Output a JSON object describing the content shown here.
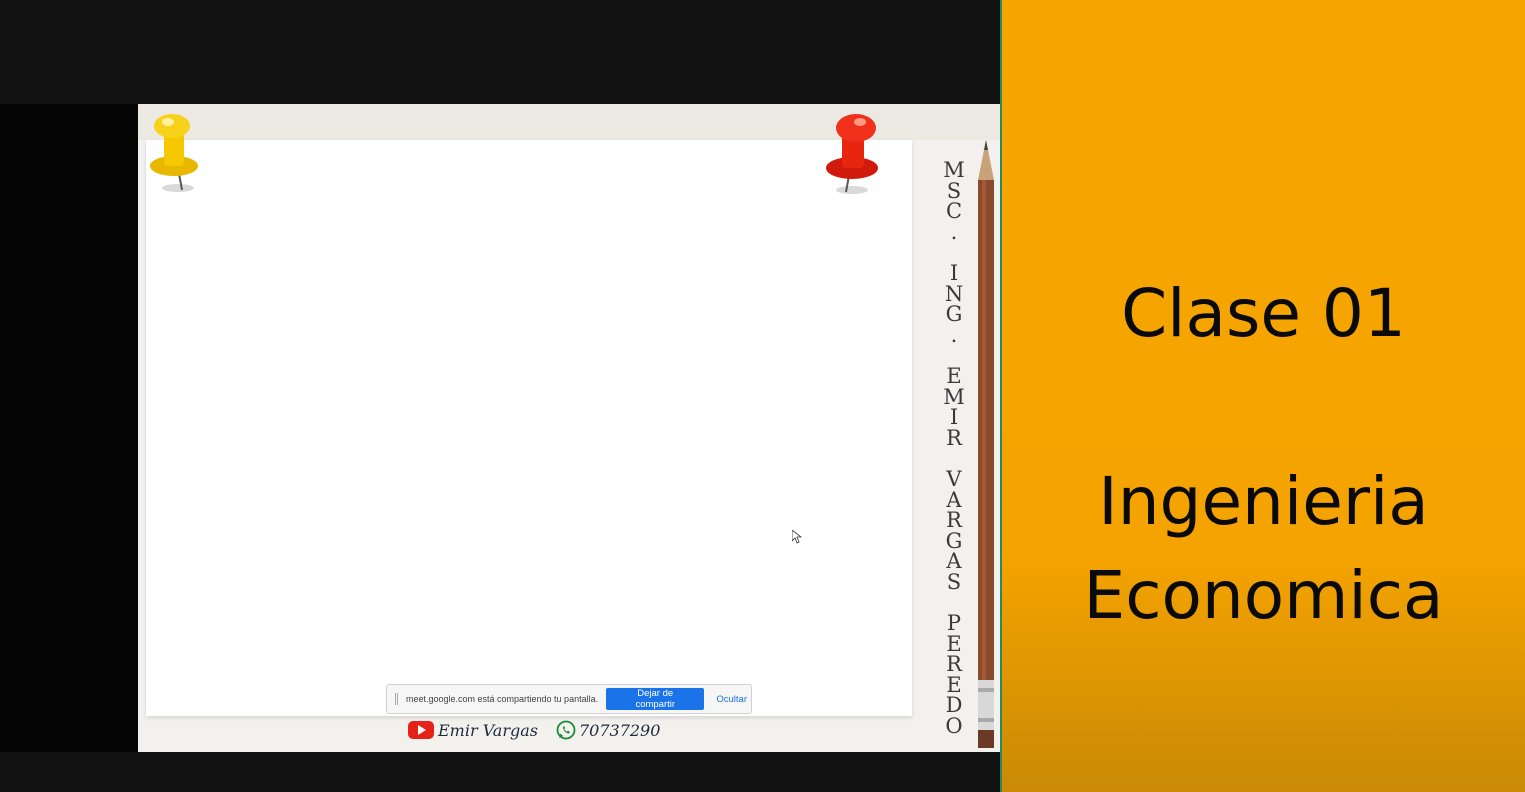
{
  "slide": {
    "author_vertical": "MSC. ING. EMIR VARGAS PEREDO",
    "footer": {
      "channel_name": "Emir Vargas",
      "whatsapp_number": "70737290"
    }
  },
  "share_bar": {
    "message": "meet.google.com está compartiendo tu pantalla.",
    "stop_label": "Dejar de compartir",
    "hide_label": "Ocultar"
  },
  "panel": {
    "lesson": "Clase 01",
    "course_line1": "Ingenieria",
    "course_line2": "Economica",
    "background_color": "#f7a500"
  },
  "icons": [
    "youtube-icon",
    "whatsapp-icon",
    "pushpin-yellow-icon",
    "pushpin-red-icon",
    "pencil-icon",
    "mouse-cursor-icon"
  ]
}
